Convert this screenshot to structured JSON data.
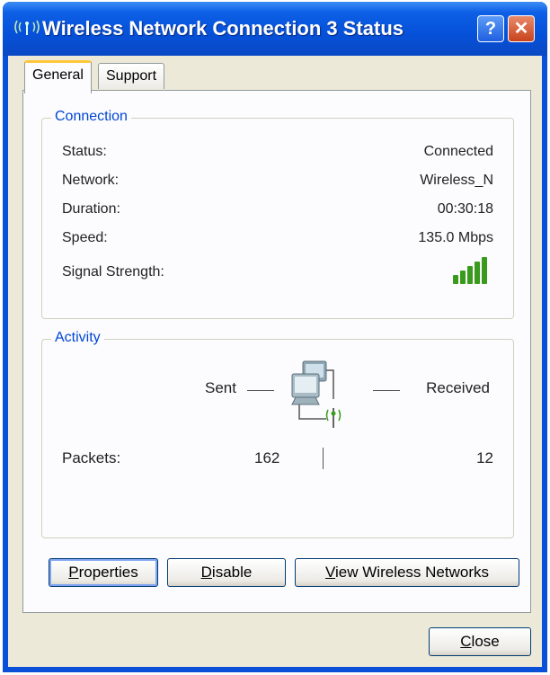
{
  "window": {
    "title": "Wireless Network Connection 3 Status",
    "icon": "wireless-icon"
  },
  "titlebar": {
    "help_label": "?",
    "close_label": "✕"
  },
  "tabs": [
    {
      "label": "General"
    },
    {
      "label": "Support"
    }
  ],
  "connection": {
    "group_label": "Connection",
    "rows": [
      {
        "label": "Status:",
        "value": "Connected"
      },
      {
        "label": "Network:",
        "value": "Wireless_N"
      },
      {
        "label": "Duration:",
        "value": "00:30:18"
      },
      {
        "label": "Speed:",
        "value": "135.0 Mbps"
      },
      {
        "label": "Signal Strength:",
        "value": ""
      }
    ],
    "signal_bars_lit": 5,
    "signal_bars_total": 5
  },
  "activity": {
    "group_label": "Activity",
    "sent_label": "Sent",
    "received_label": "Received",
    "packets_label": "Packets:",
    "packets_sent": "162",
    "packets_received": "12"
  },
  "buttons": {
    "properties": {
      "pre": "",
      "key": "P",
      "post": "roperties"
    },
    "disable": {
      "pre": "",
      "key": "D",
      "post": "isable"
    },
    "view_wireless": {
      "pre": "",
      "key": "V",
      "post": "iew Wireless Networks"
    },
    "close": {
      "pre": "",
      "key": "C",
      "post": "lose"
    }
  },
  "colors": {
    "titlebar": "#0651d9",
    "signal_green": "#3a9a1c",
    "group_label": "#0046d5",
    "tab_accent": "#ffc83c"
  }
}
